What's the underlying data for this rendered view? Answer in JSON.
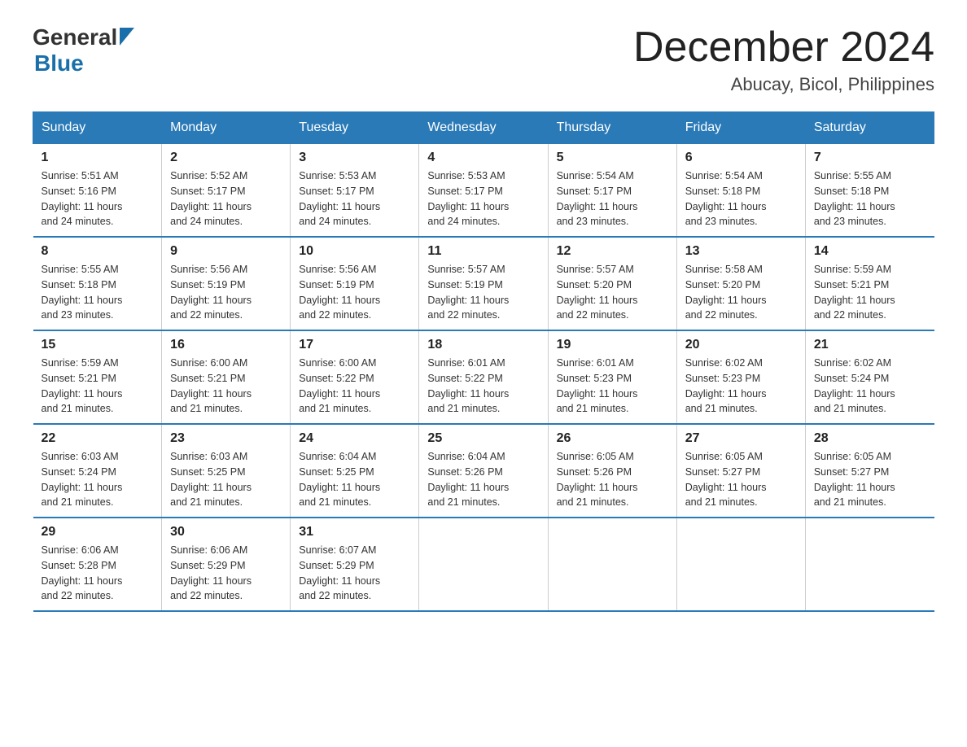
{
  "header": {
    "logo_general": "General",
    "logo_blue": "Blue",
    "month_title": "December 2024",
    "location": "Abucay, Bicol, Philippines"
  },
  "days_of_week": [
    "Sunday",
    "Monday",
    "Tuesday",
    "Wednesday",
    "Thursday",
    "Friday",
    "Saturday"
  ],
  "weeks": [
    [
      {
        "day": "1",
        "sunrise": "5:51 AM",
        "sunset": "5:16 PM",
        "daylight": "11 hours and 24 minutes."
      },
      {
        "day": "2",
        "sunrise": "5:52 AM",
        "sunset": "5:17 PM",
        "daylight": "11 hours and 24 minutes."
      },
      {
        "day": "3",
        "sunrise": "5:53 AM",
        "sunset": "5:17 PM",
        "daylight": "11 hours and 24 minutes."
      },
      {
        "day": "4",
        "sunrise": "5:53 AM",
        "sunset": "5:17 PM",
        "daylight": "11 hours and 24 minutes."
      },
      {
        "day": "5",
        "sunrise": "5:54 AM",
        "sunset": "5:17 PM",
        "daylight": "11 hours and 23 minutes."
      },
      {
        "day": "6",
        "sunrise": "5:54 AM",
        "sunset": "5:18 PM",
        "daylight": "11 hours and 23 minutes."
      },
      {
        "day": "7",
        "sunrise": "5:55 AM",
        "sunset": "5:18 PM",
        "daylight": "11 hours and 23 minutes."
      }
    ],
    [
      {
        "day": "8",
        "sunrise": "5:55 AM",
        "sunset": "5:18 PM",
        "daylight": "11 hours and 23 minutes."
      },
      {
        "day": "9",
        "sunrise": "5:56 AM",
        "sunset": "5:19 PM",
        "daylight": "11 hours and 22 minutes."
      },
      {
        "day": "10",
        "sunrise": "5:56 AM",
        "sunset": "5:19 PM",
        "daylight": "11 hours and 22 minutes."
      },
      {
        "day": "11",
        "sunrise": "5:57 AM",
        "sunset": "5:19 PM",
        "daylight": "11 hours and 22 minutes."
      },
      {
        "day": "12",
        "sunrise": "5:57 AM",
        "sunset": "5:20 PM",
        "daylight": "11 hours and 22 minutes."
      },
      {
        "day": "13",
        "sunrise": "5:58 AM",
        "sunset": "5:20 PM",
        "daylight": "11 hours and 22 minutes."
      },
      {
        "day": "14",
        "sunrise": "5:59 AM",
        "sunset": "5:21 PM",
        "daylight": "11 hours and 22 minutes."
      }
    ],
    [
      {
        "day": "15",
        "sunrise": "5:59 AM",
        "sunset": "5:21 PM",
        "daylight": "11 hours and 21 minutes."
      },
      {
        "day": "16",
        "sunrise": "6:00 AM",
        "sunset": "5:21 PM",
        "daylight": "11 hours and 21 minutes."
      },
      {
        "day": "17",
        "sunrise": "6:00 AM",
        "sunset": "5:22 PM",
        "daylight": "11 hours and 21 minutes."
      },
      {
        "day": "18",
        "sunrise": "6:01 AM",
        "sunset": "5:22 PM",
        "daylight": "11 hours and 21 minutes."
      },
      {
        "day": "19",
        "sunrise": "6:01 AM",
        "sunset": "5:23 PM",
        "daylight": "11 hours and 21 minutes."
      },
      {
        "day": "20",
        "sunrise": "6:02 AM",
        "sunset": "5:23 PM",
        "daylight": "11 hours and 21 minutes."
      },
      {
        "day": "21",
        "sunrise": "6:02 AM",
        "sunset": "5:24 PM",
        "daylight": "11 hours and 21 minutes."
      }
    ],
    [
      {
        "day": "22",
        "sunrise": "6:03 AM",
        "sunset": "5:24 PM",
        "daylight": "11 hours and 21 minutes."
      },
      {
        "day": "23",
        "sunrise": "6:03 AM",
        "sunset": "5:25 PM",
        "daylight": "11 hours and 21 minutes."
      },
      {
        "day": "24",
        "sunrise": "6:04 AM",
        "sunset": "5:25 PM",
        "daylight": "11 hours and 21 minutes."
      },
      {
        "day": "25",
        "sunrise": "6:04 AM",
        "sunset": "5:26 PM",
        "daylight": "11 hours and 21 minutes."
      },
      {
        "day": "26",
        "sunrise": "6:05 AM",
        "sunset": "5:26 PM",
        "daylight": "11 hours and 21 minutes."
      },
      {
        "day": "27",
        "sunrise": "6:05 AM",
        "sunset": "5:27 PM",
        "daylight": "11 hours and 21 minutes."
      },
      {
        "day": "28",
        "sunrise": "6:05 AM",
        "sunset": "5:27 PM",
        "daylight": "11 hours and 21 minutes."
      }
    ],
    [
      {
        "day": "29",
        "sunrise": "6:06 AM",
        "sunset": "5:28 PM",
        "daylight": "11 hours and 22 minutes."
      },
      {
        "day": "30",
        "sunrise": "6:06 AM",
        "sunset": "5:29 PM",
        "daylight": "11 hours and 22 minutes."
      },
      {
        "day": "31",
        "sunrise": "6:07 AM",
        "sunset": "5:29 PM",
        "daylight": "11 hours and 22 minutes."
      },
      null,
      null,
      null,
      null
    ]
  ],
  "labels": {
    "sunrise": "Sunrise:",
    "sunset": "Sunset:",
    "daylight": "Daylight:"
  }
}
